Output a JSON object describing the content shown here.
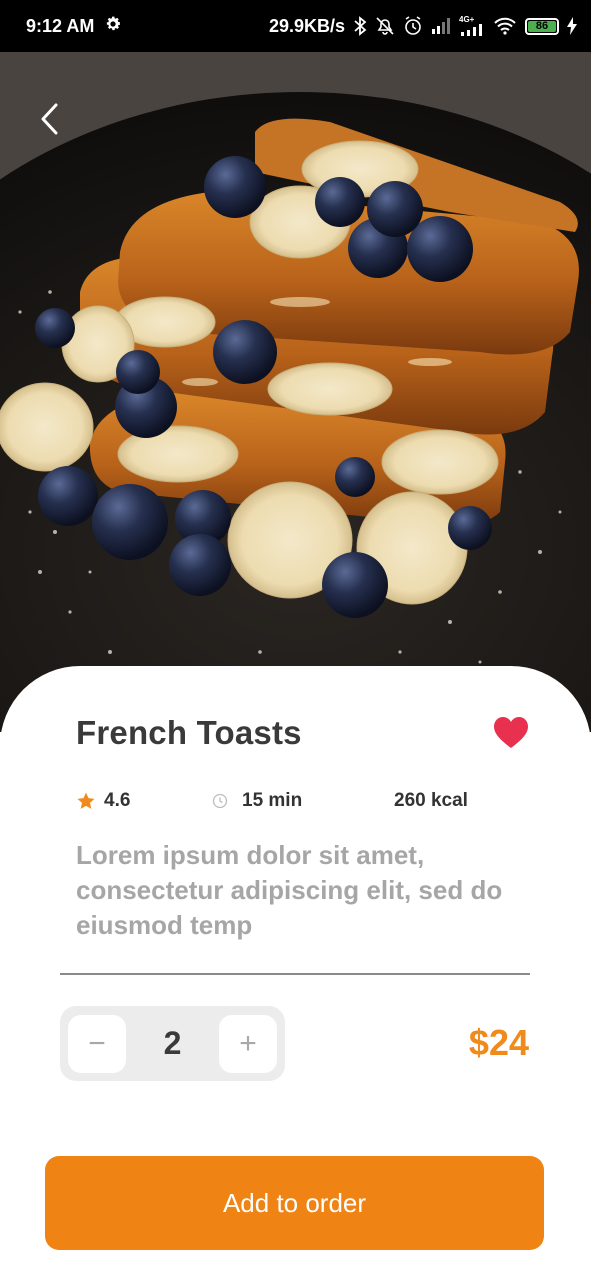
{
  "status_bar": {
    "time": "9:12 AM",
    "speed": "29.9KB/s",
    "battery": "86",
    "network": "4G+",
    "icons": [
      "gear-icon",
      "bluetooth-icon",
      "mute-icon",
      "alarm-icon",
      "signal-icon",
      "signal-4g-icon",
      "wifi-icon",
      "battery-icon",
      "charging-icon"
    ]
  },
  "hero": {
    "icon_back": "chevron-left-icon"
  },
  "product": {
    "title": "French Toasts",
    "favorite": true,
    "rating": "4.6",
    "time": "15 min",
    "calories": "260 kcal",
    "description": "Lorem ipsum dolor sit amet, consectetur adipiscing elit, sed do eiusmod temp"
  },
  "order": {
    "minus": "−",
    "quantity": "2",
    "plus": "+",
    "price": "$24",
    "cta": "Add to order"
  },
  "colors": {
    "accent": "#ef8314",
    "price": "#ef8a1b",
    "heart": "#e8304f",
    "star": "#ef8a1b"
  }
}
